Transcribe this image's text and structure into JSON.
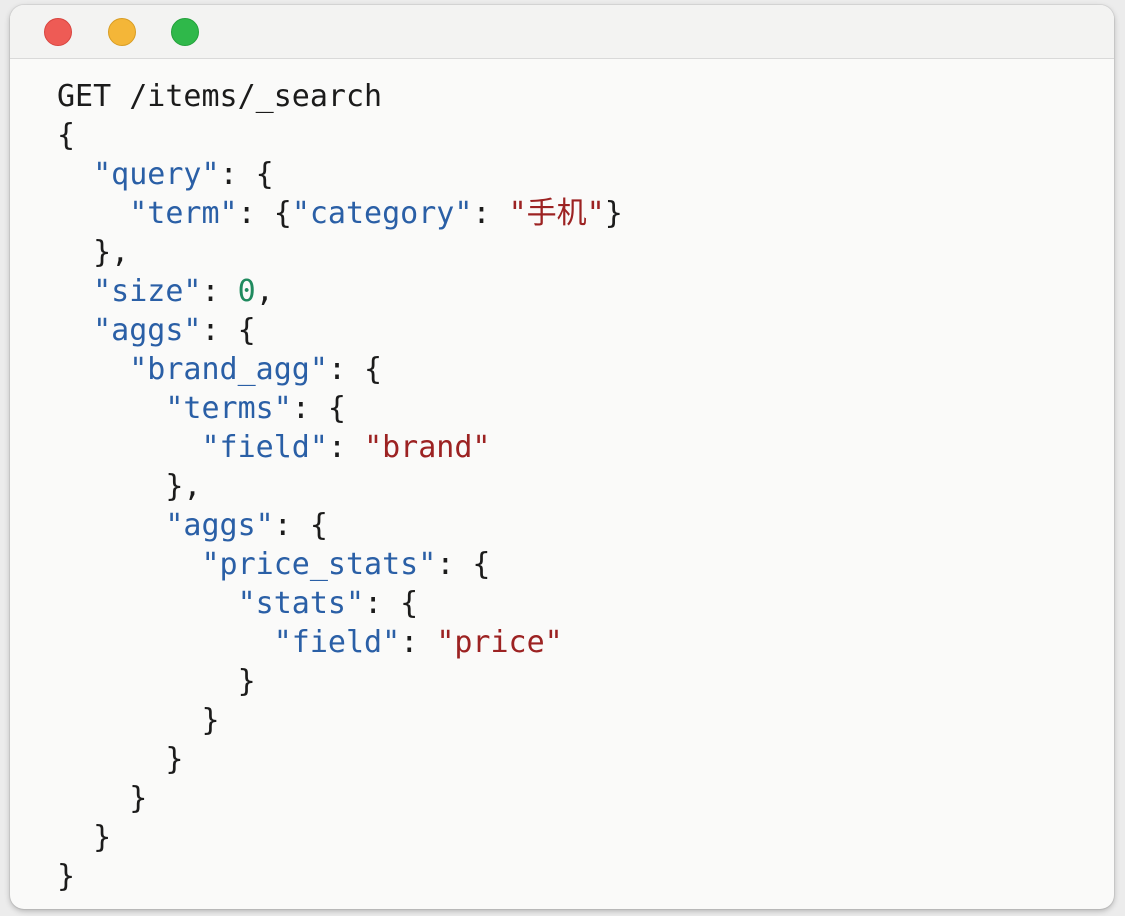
{
  "window": {
    "controls": {
      "close": "close-button",
      "minimize": "minimize-button",
      "zoom": "zoom-button"
    }
  },
  "code": {
    "lines": [
      [
        {
          "t": "GET /items/_search",
          "k": "plain"
        }
      ],
      [
        {
          "t": "{",
          "k": "plain"
        }
      ],
      [
        {
          "t": "  ",
          "k": "plain"
        },
        {
          "t": "\"query\"",
          "k": "key"
        },
        {
          "t": ": {",
          "k": "plain"
        }
      ],
      [
        {
          "t": "    ",
          "k": "plain"
        },
        {
          "t": "\"term\"",
          "k": "key"
        },
        {
          "t": ": {",
          "k": "plain"
        },
        {
          "t": "\"category\"",
          "k": "key"
        },
        {
          "t": ": ",
          "k": "plain"
        },
        {
          "t": "\"手机\"",
          "k": "str"
        },
        {
          "t": "}",
          "k": "plain"
        }
      ],
      [
        {
          "t": "  },",
          "k": "plain"
        }
      ],
      [
        {
          "t": "  ",
          "k": "plain"
        },
        {
          "t": "\"size\"",
          "k": "key"
        },
        {
          "t": ": ",
          "k": "plain"
        },
        {
          "t": "0",
          "k": "num"
        },
        {
          "t": ",",
          "k": "plain"
        }
      ],
      [
        {
          "t": "  ",
          "k": "plain"
        },
        {
          "t": "\"aggs\"",
          "k": "key"
        },
        {
          "t": ": {",
          "k": "plain"
        }
      ],
      [
        {
          "t": "    ",
          "k": "plain"
        },
        {
          "t": "\"brand_agg\"",
          "k": "key"
        },
        {
          "t": ": {",
          "k": "plain"
        }
      ],
      [
        {
          "t": "      ",
          "k": "plain"
        },
        {
          "t": "\"terms\"",
          "k": "key"
        },
        {
          "t": ": {",
          "k": "plain"
        }
      ],
      [
        {
          "t": "        ",
          "k": "plain"
        },
        {
          "t": "\"field\"",
          "k": "key"
        },
        {
          "t": ": ",
          "k": "plain"
        },
        {
          "t": "\"brand\"",
          "k": "str"
        }
      ],
      [
        {
          "t": "      },",
          "k": "plain"
        }
      ],
      [
        {
          "t": "      ",
          "k": "plain"
        },
        {
          "t": "\"aggs\"",
          "k": "key"
        },
        {
          "t": ": {",
          "k": "plain"
        }
      ],
      [
        {
          "t": "        ",
          "k": "plain"
        },
        {
          "t": "\"price_stats\"",
          "k": "key"
        },
        {
          "t": ": {",
          "k": "plain"
        }
      ],
      [
        {
          "t": "          ",
          "k": "plain"
        },
        {
          "t": "\"stats\"",
          "k": "key"
        },
        {
          "t": ": {",
          "k": "plain"
        }
      ],
      [
        {
          "t": "            ",
          "k": "plain"
        },
        {
          "t": "\"field\"",
          "k": "key"
        },
        {
          "t": ": ",
          "k": "plain"
        },
        {
          "t": "\"price\"",
          "k": "str"
        }
      ],
      [
        {
          "t": "          }",
          "k": "plain"
        }
      ],
      [
        {
          "t": "        }",
          "k": "plain"
        }
      ],
      [
        {
          "t": "      }",
          "k": "plain"
        }
      ],
      [
        {
          "t": "    }",
          "k": "plain"
        }
      ],
      [
        {
          "t": "  }",
          "k": "plain"
        }
      ],
      [
        {
          "t": "}",
          "k": "plain"
        }
      ]
    ]
  },
  "colors": {
    "key": "#2a5fa6",
    "string": "#9c2222",
    "number": "#1f8a5e",
    "plain": "#1b1b1b",
    "close": "#ee5b55",
    "minimize": "#f4b638",
    "zoom": "#2fb84a"
  }
}
